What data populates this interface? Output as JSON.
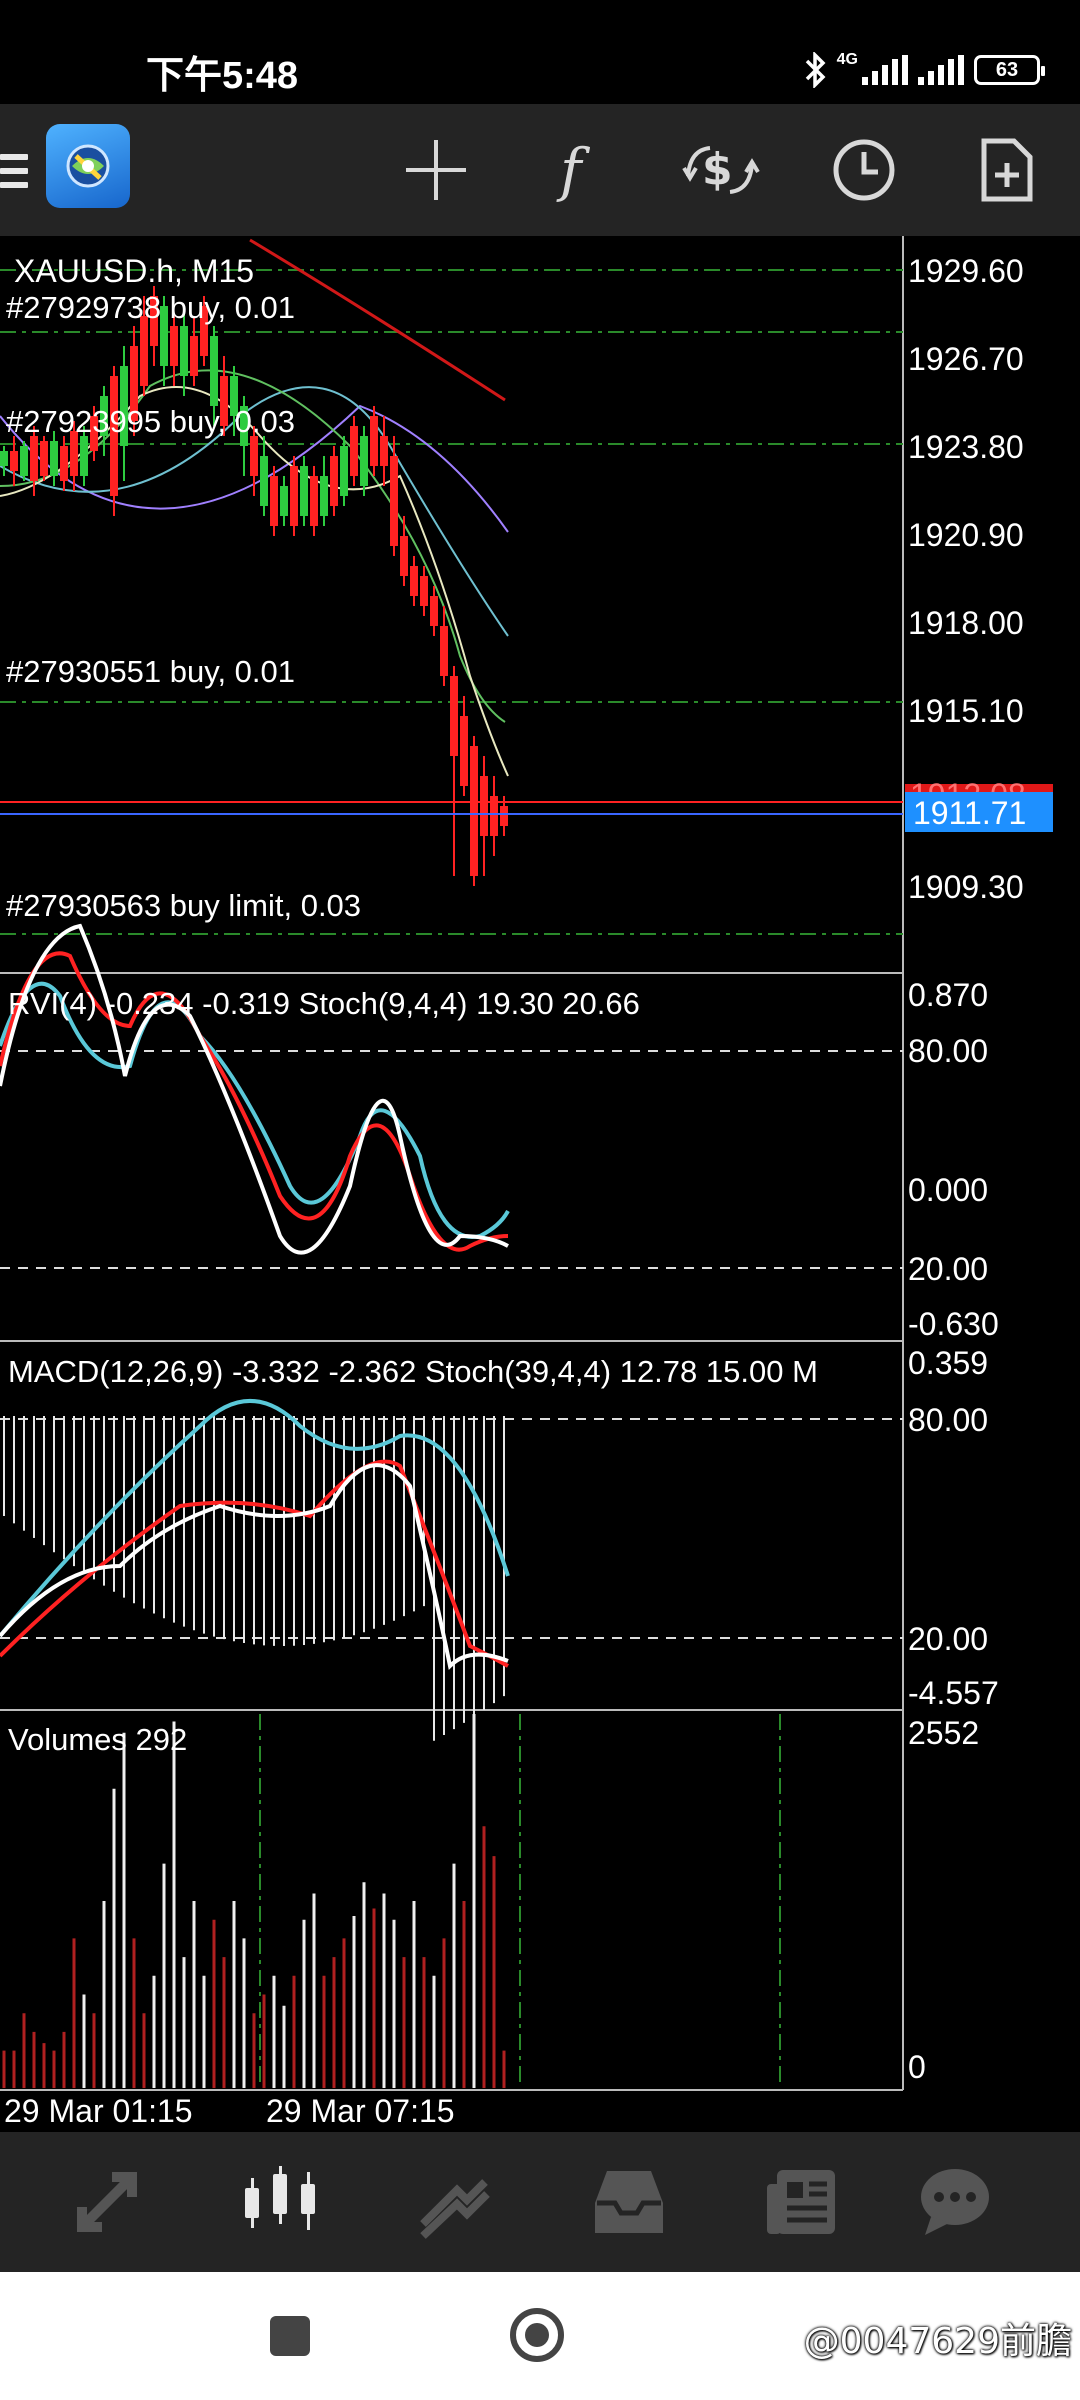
{
  "status_bar": {
    "time": "下午5:48",
    "network": "4G",
    "battery": "63"
  },
  "toolbar": {
    "icons": [
      "menu-icon",
      "metatrader-logo",
      "crosshair-icon",
      "indicators-icon",
      "objects-icon",
      "timeframe-clock-icon",
      "new-order-icon"
    ]
  },
  "chart": {
    "symbol_label": "XAUUSD.h, M15",
    "price_axis": [
      "1929.60",
      "1926.70",
      "1923.80",
      "1920.90",
      "1918.00",
      "1915.10",
      "1909.30"
    ],
    "current_price": "1911.71",
    "partial_price": "1912.08",
    "orders": [
      "#27929738 buy, 0.01",
      "#27923995 buy, 0.03",
      "#27930551 buy, 0.01",
      "#27930563 buy limit, 0.03"
    ],
    "time_axis": [
      "29 Mar 01:15",
      "29 Mar 07:15"
    ],
    "colors": {
      "bull": "#2ecc40",
      "bear": "#ff2222",
      "grid": "#2a8a2a",
      "ask_line": "#ff2222",
      "bid_line": "#3a66ff",
      "price_tag": "#1e90ff"
    }
  },
  "rvi_panel": {
    "label": "RVI(4) -0.234 -0.319 Stoch(9,4,4) 19.30 20.66",
    "axis": [
      "0.870",
      "80.00",
      "0.000",
      "20.00",
      "-0.630"
    ]
  },
  "macd_panel": {
    "label": "MACD(12,26,9) -3.332 -2.362 Stoch(39,4,4) 12.78 15.00 M",
    "axis": [
      "0.359",
      "80.00",
      "20.00",
      "-4.557"
    ]
  },
  "volume_panel": {
    "label": "Volumes 292",
    "axis": [
      "2552",
      "0"
    ]
  },
  "bottom_nav": {
    "items": [
      "quotes",
      "chart",
      "trade",
      "history",
      "news",
      "chat"
    ],
    "active": "chart"
  },
  "watermark": "@0047629前膽"
}
